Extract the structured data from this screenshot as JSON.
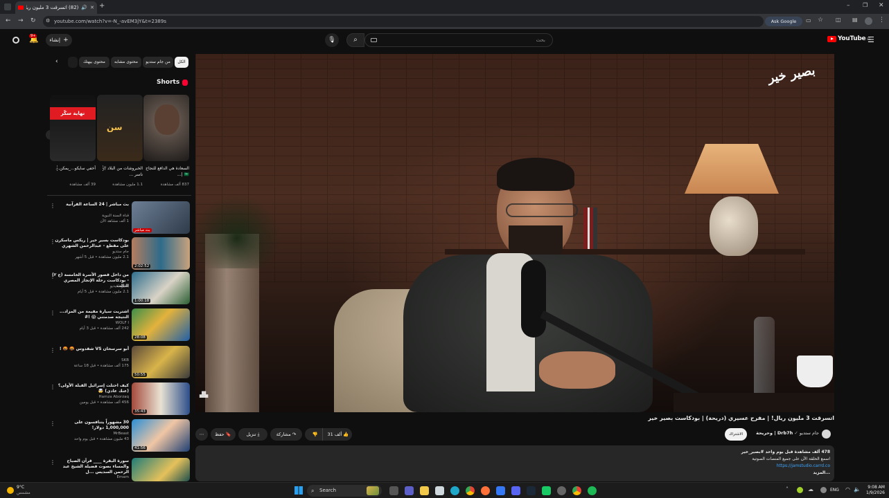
{
  "browser": {
    "tab_title": "(82) اتسرقت 3 مليون ريال! |",
    "url": "youtube.com/watch?v=-N_-avEM3jY&t=2389s",
    "ask_google": "Ask Google"
  },
  "header": {
    "create_label": "إنشاء",
    "notif_count": "9+",
    "search_placeholder": "بحث",
    "logo_text": "YouTube",
    "logo_sup": "EG"
  },
  "chips": [
    "الكل",
    "من جام ستديو",
    "محتوى مشابه",
    "محتوى بيهتك"
  ],
  "shorts": {
    "title": "Shorts",
    "items": [
      {
        "title": "السعادة هي الدافع للنجاح 🇸🇦 |...",
        "views": "837 ألف مشاهدة"
      },
      {
        "title": "الخبروشات من البلاد // ناسر ...",
        "views": "1.1 مليون مشاهدة"
      },
      {
        "title": "أخفي سايكو..._يمكن...",
        "views": "39 ألف مشاهدة",
        "badge": "نهاية سكّر"
      }
    ]
  },
  "recommendations": [
    {
      "title": "بث مباشر | 24 الساعة القرآنية",
      "channel": "قناة السنة النبوية",
      "meta": "1 ألف مشاهد الآن",
      "duration": "بث مباشر"
    },
    {
      "title": "بودكاست بسير خير | ريكس ماسكرن على مقطع - عبدالرحمن الشهري",
      "channel": "جام ستديو",
      "meta": "2.1 مليون مشاهدة • قبل 5 أشهر",
      "duration": "2:02:52"
    },
    {
      "title": "من داخل قصور الأسرة الخامسة (ج ٢) - بودكاست رحلة الإنجاز المصري الثالث",
      "channel": "بصيرة فيديو",
      "meta": "2.1 مليون مشاهدة • قبل 5 أيام",
      "duration": "1:00:18"
    },
    {
      "title": "اشتريت سيارة مقيمة من المزاد... النتيجة صدمتني 😱 !#",
      "channel": "WOLF I",
      "meta": "242 ألف مشاهدة • قبل 3 أيام",
      "duration": "28:08"
    },
    {
      "title": "أبو سرسحان VS شقدوس 🤬 🤬 !",
      "channel": "SKB",
      "meta": "175 ألف مشاهدة • قبل 18 ساعة",
      "duration": "50:55"
    },
    {
      "title": "كيف احتلت إسرائيل القبلة الأولى؟ (عنك عادي) 🤯",
      "channel": "Hamza Aborzaq",
      "meta": "456 ألف مشاهدة • قبل يومين",
      "duration": "35:43"
    },
    {
      "title": "30 مشهوراً يتنافسون على 1,000,000 دولار!",
      "channel": "MrBeast",
      "meta": "43 مليون مشاهدة • قبل يوم واحد",
      "duration": "41:56"
    },
    {
      "title": "سورة البقرة ____ قرآن الصباح والمساء بصوت فضيلة الشيخ عبد الرحمن السديس ...ل",
      "channel": "Emam",
      "meta": "",
      "duration": ""
    }
  ],
  "video": {
    "title": "اتسرقت 3 مليون ريال! | مفرح عسيري (دريحة) | بودكاست بصير خير",
    "channel_name": "Drb7h | وحريحة",
    "channel_sub": "جام ستديو",
    "subscribe": "الاشتراك",
    "likes": "31 ألف",
    "share": "مشاركة",
    "download": "تنزيل",
    "save": "حفظ",
    "watermark": "بصير خير"
  },
  "description": {
    "stats": "478 ألف مشاهدة  قبل يوم واحد  #بصير_خير",
    "line1": "اسمع الحلقة الآن على جميع المنصات الصوتية",
    "link": "https://jamstudio.carrd.co",
    "more": "...المزيد"
  },
  "taskbar": {
    "weather_temp": "9°C",
    "weather_desc": "مشمس",
    "search": "Search",
    "lang": "ENG",
    "time": "9:08 AM",
    "date": "1/9/2026"
  }
}
